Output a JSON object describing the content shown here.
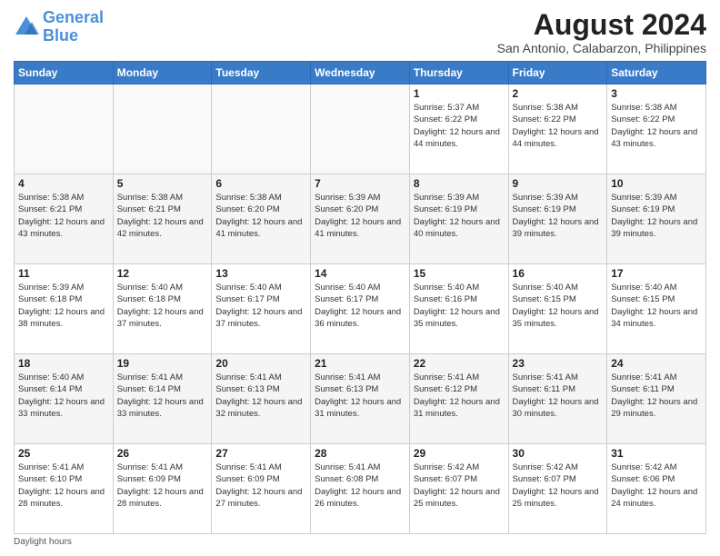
{
  "logo": {
    "line1": "General",
    "line2": "Blue"
  },
  "title": "August 2024",
  "subtitle": "San Antonio, Calabarzon, Philippines",
  "days_header": [
    "Sunday",
    "Monday",
    "Tuesday",
    "Wednesday",
    "Thursday",
    "Friday",
    "Saturday"
  ],
  "footer": "Daylight hours",
  "weeks": [
    [
      {
        "day": "",
        "info": ""
      },
      {
        "day": "",
        "info": ""
      },
      {
        "day": "",
        "info": ""
      },
      {
        "day": "",
        "info": ""
      },
      {
        "day": "1",
        "info": "Sunrise: 5:37 AM\nSunset: 6:22 PM\nDaylight: 12 hours\nand 44 minutes."
      },
      {
        "day": "2",
        "info": "Sunrise: 5:38 AM\nSunset: 6:22 PM\nDaylight: 12 hours\nand 44 minutes."
      },
      {
        "day": "3",
        "info": "Sunrise: 5:38 AM\nSunset: 6:22 PM\nDaylight: 12 hours\nand 43 minutes."
      }
    ],
    [
      {
        "day": "4",
        "info": "Sunrise: 5:38 AM\nSunset: 6:21 PM\nDaylight: 12 hours\nand 43 minutes."
      },
      {
        "day": "5",
        "info": "Sunrise: 5:38 AM\nSunset: 6:21 PM\nDaylight: 12 hours\nand 42 minutes."
      },
      {
        "day": "6",
        "info": "Sunrise: 5:38 AM\nSunset: 6:20 PM\nDaylight: 12 hours\nand 41 minutes."
      },
      {
        "day": "7",
        "info": "Sunrise: 5:39 AM\nSunset: 6:20 PM\nDaylight: 12 hours\nand 41 minutes."
      },
      {
        "day": "8",
        "info": "Sunrise: 5:39 AM\nSunset: 6:19 PM\nDaylight: 12 hours\nand 40 minutes."
      },
      {
        "day": "9",
        "info": "Sunrise: 5:39 AM\nSunset: 6:19 PM\nDaylight: 12 hours\nand 39 minutes."
      },
      {
        "day": "10",
        "info": "Sunrise: 5:39 AM\nSunset: 6:19 PM\nDaylight: 12 hours\nand 39 minutes."
      }
    ],
    [
      {
        "day": "11",
        "info": "Sunrise: 5:39 AM\nSunset: 6:18 PM\nDaylight: 12 hours\nand 38 minutes."
      },
      {
        "day": "12",
        "info": "Sunrise: 5:40 AM\nSunset: 6:18 PM\nDaylight: 12 hours\nand 37 minutes."
      },
      {
        "day": "13",
        "info": "Sunrise: 5:40 AM\nSunset: 6:17 PM\nDaylight: 12 hours\nand 37 minutes."
      },
      {
        "day": "14",
        "info": "Sunrise: 5:40 AM\nSunset: 6:17 PM\nDaylight: 12 hours\nand 36 minutes."
      },
      {
        "day": "15",
        "info": "Sunrise: 5:40 AM\nSunset: 6:16 PM\nDaylight: 12 hours\nand 35 minutes."
      },
      {
        "day": "16",
        "info": "Sunrise: 5:40 AM\nSunset: 6:15 PM\nDaylight: 12 hours\nand 35 minutes."
      },
      {
        "day": "17",
        "info": "Sunrise: 5:40 AM\nSunset: 6:15 PM\nDaylight: 12 hours\nand 34 minutes."
      }
    ],
    [
      {
        "day": "18",
        "info": "Sunrise: 5:40 AM\nSunset: 6:14 PM\nDaylight: 12 hours\nand 33 minutes."
      },
      {
        "day": "19",
        "info": "Sunrise: 5:41 AM\nSunset: 6:14 PM\nDaylight: 12 hours\nand 33 minutes."
      },
      {
        "day": "20",
        "info": "Sunrise: 5:41 AM\nSunset: 6:13 PM\nDaylight: 12 hours\nand 32 minutes."
      },
      {
        "day": "21",
        "info": "Sunrise: 5:41 AM\nSunset: 6:13 PM\nDaylight: 12 hours\nand 31 minutes."
      },
      {
        "day": "22",
        "info": "Sunrise: 5:41 AM\nSunset: 6:12 PM\nDaylight: 12 hours\nand 31 minutes."
      },
      {
        "day": "23",
        "info": "Sunrise: 5:41 AM\nSunset: 6:11 PM\nDaylight: 12 hours\nand 30 minutes."
      },
      {
        "day": "24",
        "info": "Sunrise: 5:41 AM\nSunset: 6:11 PM\nDaylight: 12 hours\nand 29 minutes."
      }
    ],
    [
      {
        "day": "25",
        "info": "Sunrise: 5:41 AM\nSunset: 6:10 PM\nDaylight: 12 hours\nand 28 minutes."
      },
      {
        "day": "26",
        "info": "Sunrise: 5:41 AM\nSunset: 6:09 PM\nDaylight: 12 hours\nand 28 minutes."
      },
      {
        "day": "27",
        "info": "Sunrise: 5:41 AM\nSunset: 6:09 PM\nDaylight: 12 hours\nand 27 minutes."
      },
      {
        "day": "28",
        "info": "Sunrise: 5:41 AM\nSunset: 6:08 PM\nDaylight: 12 hours\nand 26 minutes."
      },
      {
        "day": "29",
        "info": "Sunrise: 5:42 AM\nSunset: 6:07 PM\nDaylight: 12 hours\nand 25 minutes."
      },
      {
        "day": "30",
        "info": "Sunrise: 5:42 AM\nSunset: 6:07 PM\nDaylight: 12 hours\nand 25 minutes."
      },
      {
        "day": "31",
        "info": "Sunrise: 5:42 AM\nSunset: 6:06 PM\nDaylight: 12 hours\nand 24 minutes."
      }
    ]
  ]
}
